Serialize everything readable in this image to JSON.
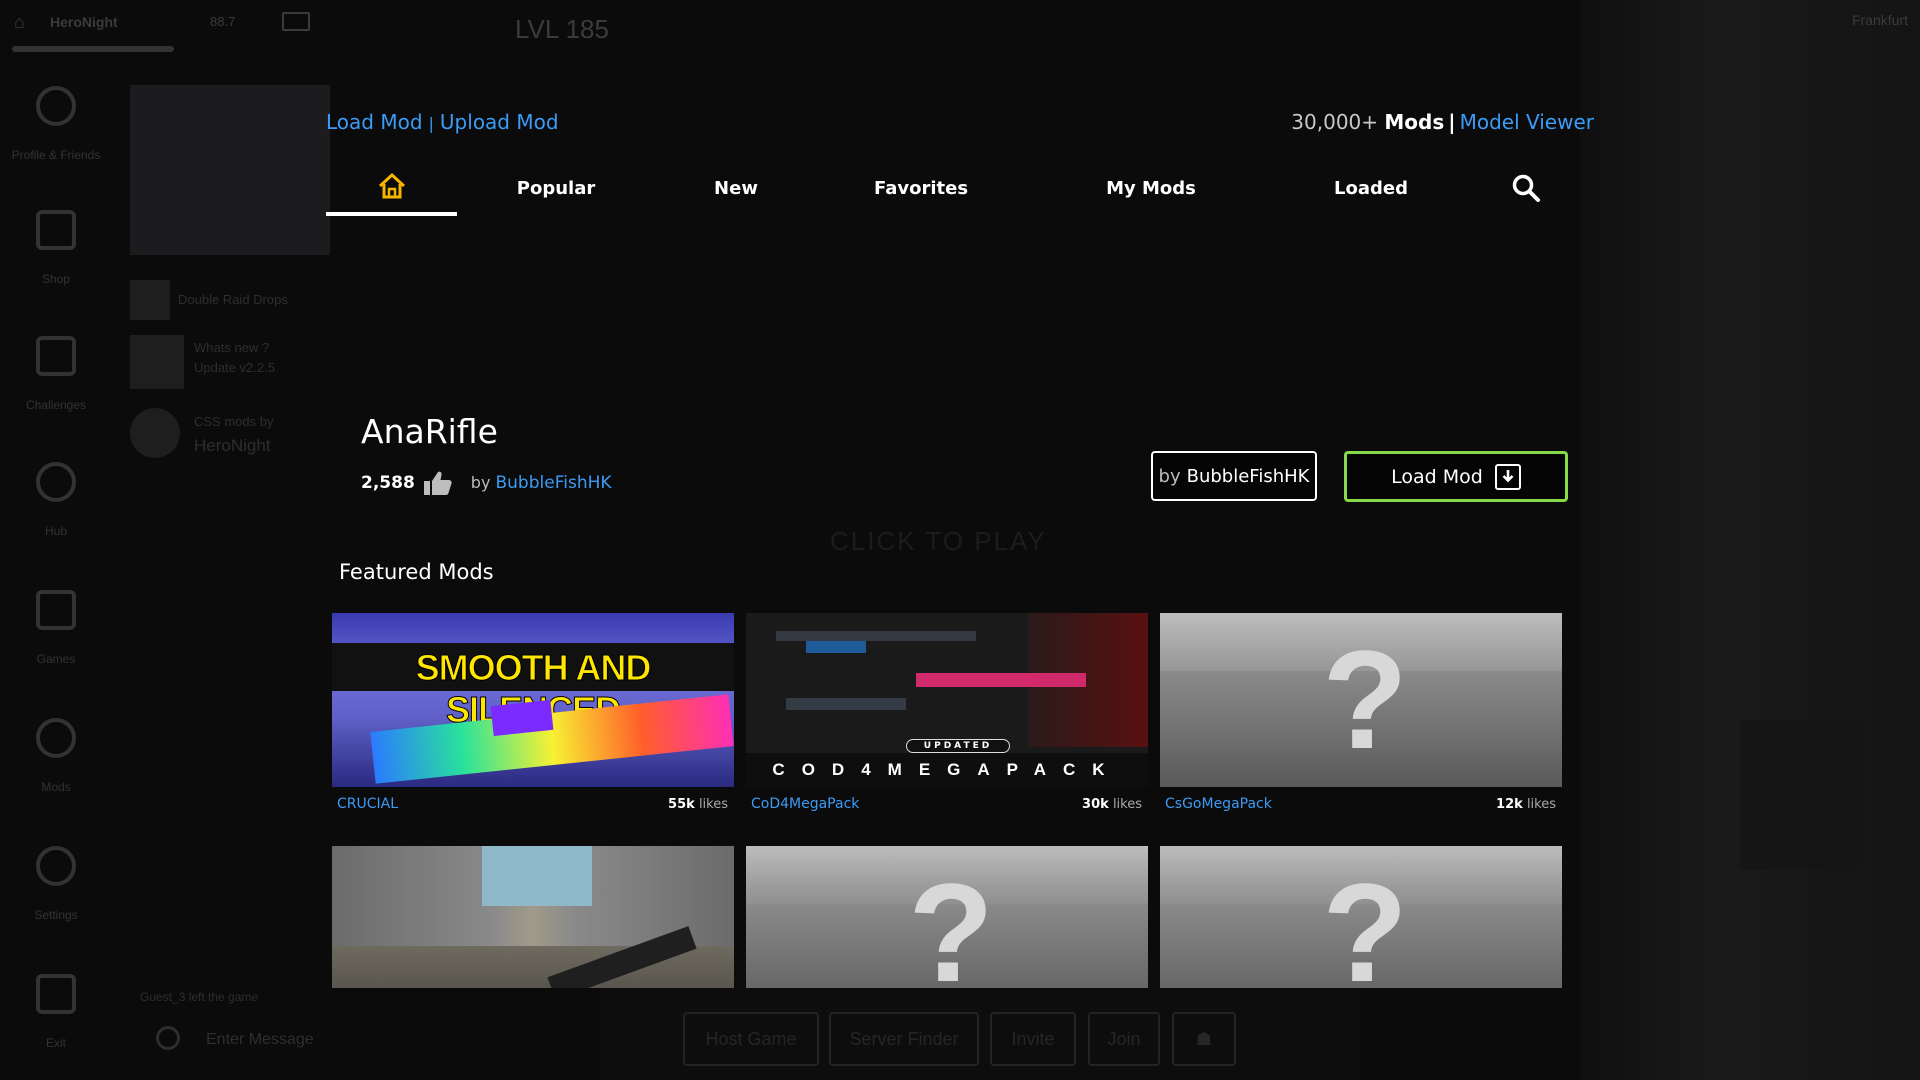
{
  "topbar": {
    "player_name": "HeroNight",
    "player_stats": "88.7",
    "level": "LVL 185",
    "region_name": "Frankfurt"
  },
  "sidebar": {
    "items": [
      {
        "label": "Profile & Friends",
        "icon": "person-icon"
      },
      {
        "label": "Shop",
        "icon": "shop-icon"
      },
      {
        "label": "Challenges",
        "icon": "flag-icon"
      },
      {
        "label": "Hub",
        "icon": "globe-icon"
      },
      {
        "label": "Games",
        "icon": "gamepad-icon"
      },
      {
        "label": "Mods",
        "icon": "palette-icon"
      },
      {
        "label": "Settings",
        "icon": "gear-icon"
      },
      {
        "label": "Exit",
        "icon": "exit-icon"
      }
    ]
  },
  "news": {
    "item1": "Double Raid Drops",
    "item2_title": "Whats new ?",
    "item2_sub": "Update v2.2.5",
    "item3_title": "CSS mods by",
    "item3_sub": "HeroNight"
  },
  "chat": {
    "system_message": "Guest_3 left the game",
    "placeholder": "Enter Message"
  },
  "background_hint": "CLICK TO PLAY",
  "bottom_buttons": [
    "Host Game",
    "Server Finder",
    "Invite",
    "Join"
  ],
  "header": {
    "load_mod": "Load Mod",
    "upload_mod": "Upload Mod",
    "mods_count": "30,000+",
    "mods_label": "Mods",
    "model_viewer": "Model Viewer"
  },
  "nav": {
    "tabs": [
      "Popular",
      "New",
      "Favorites",
      "My Mods",
      "Loaded"
    ]
  },
  "selected_mod": {
    "title": "AnaRifle",
    "likes": "2,588",
    "by_prefix": "by",
    "author": "BubbleFishHK",
    "author_button_prefix": "by",
    "author_button_name": "BubbleFishHK",
    "load_button": "Load Mod"
  },
  "featured": {
    "title": "Featured Mods",
    "cards": [
      {
        "name": "CRUCIAL",
        "likes": "55k",
        "likes_suffix": "likes",
        "thumb_text": "SMOOTH AND SILENCED"
      },
      {
        "name": "CoD4MegaPack",
        "likes": "30k",
        "likes_suffix": "likes",
        "thumb_badge": "UPDATED",
        "thumb_text": "COD4MEGAPACK"
      },
      {
        "name": "CsGoMegaPack",
        "likes": "12k",
        "likes_suffix": "likes",
        "thumb_text": "?"
      },
      {
        "name": "",
        "likes": "",
        "likes_suffix": ""
      },
      {
        "name": "",
        "likes": "",
        "likes_suffix": "",
        "thumb_text": "?"
      },
      {
        "name": "",
        "likes": "",
        "likes_suffix": "",
        "thumb_text": "?"
      }
    ]
  },
  "colors": {
    "accent_link": "#3d9bf5",
    "home_icon": "#f5b400",
    "load_button_border": "#87d94c",
    "background": "#0b0b0b"
  }
}
